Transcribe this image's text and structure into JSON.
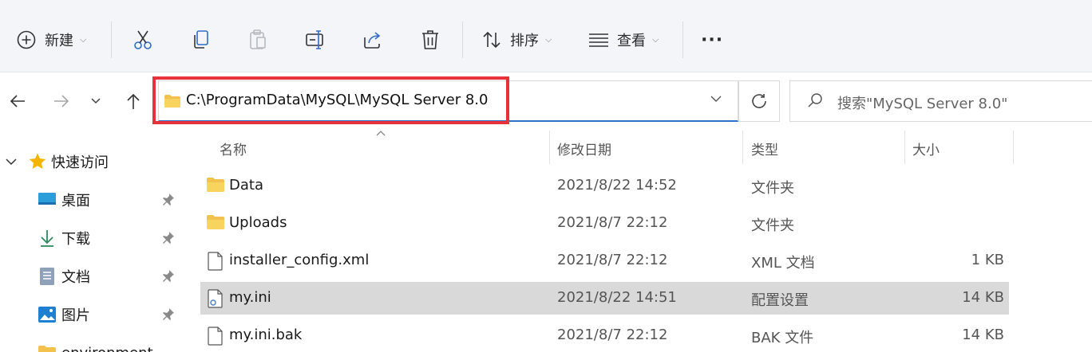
{
  "toolbar": {
    "new_label": "新建",
    "sort_label": "排序",
    "view_label": "查看",
    "more_label": "···"
  },
  "address_bar": {
    "path": "C:\\ProgramData\\MySQL\\MySQL Server 8.0"
  },
  "search": {
    "placeholder": "搜索\"MySQL Server 8.0\""
  },
  "sidebar": {
    "quick_access_label": "快速访问",
    "items": [
      {
        "label": "桌面",
        "icon": "desktop-icon"
      },
      {
        "label": "下载",
        "icon": "download-icon"
      },
      {
        "label": "文档",
        "icon": "document-icon"
      },
      {
        "label": "图片",
        "icon": "picture-icon"
      },
      {
        "label": "environment",
        "icon": "folder-icon"
      }
    ]
  },
  "columns": {
    "name": "名称",
    "date": "修改日期",
    "type": "类型",
    "size": "大小"
  },
  "files": [
    {
      "name": "Data",
      "date": "2021/8/22 14:52",
      "type": "文件夹",
      "size": "",
      "icon": "folder-icon"
    },
    {
      "name": "Uploads",
      "date": "2021/8/7 22:12",
      "type": "文件夹",
      "size": "",
      "icon": "folder-icon"
    },
    {
      "name": "installer_config.xml",
      "date": "2021/8/7 22:12",
      "type": "XML 文档",
      "size": "1 KB",
      "icon": "file-icon"
    },
    {
      "name": "my.ini",
      "date": "2021/8/22 14:51",
      "type": "配置设置",
      "size": "14 KB",
      "icon": "config-file-icon"
    },
    {
      "name": "my.ini.bak",
      "date": "2021/8/7 22:12",
      "type": "BAK 文件",
      "size": "14 KB",
      "icon": "file-icon"
    }
  ],
  "colors": {
    "highlight_border": "#e8323b",
    "selected_row": "#d9d9d9",
    "folder": "#f2c14e",
    "accent": "#2c6fcd"
  }
}
